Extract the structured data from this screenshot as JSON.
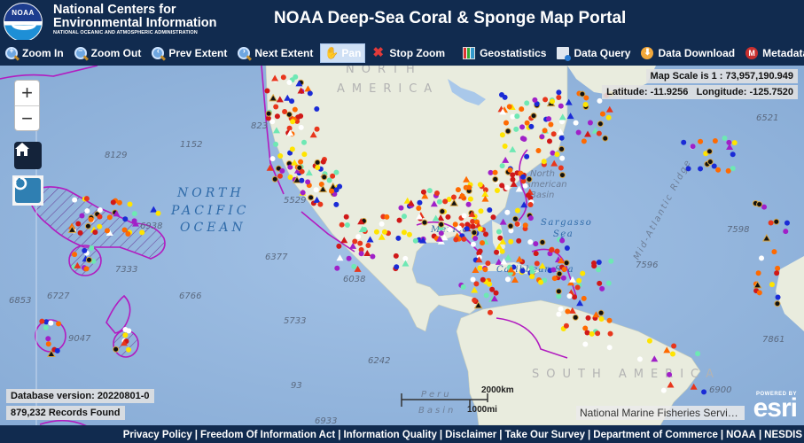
{
  "header": {
    "org_line1": "National Centers for",
    "org_line2": "Environmental Information",
    "org_sub": "NATIONAL OCEANIC AND ATMOSPHERIC ADMINISTRATION",
    "logo_text": "NOAA",
    "title": "NOAA Deep-Sea Coral & Sponge Map Portal"
  },
  "toolbar": {
    "items": [
      {
        "label": "Zoom In",
        "icon": "zoom-in-icon",
        "active": false
      },
      {
        "label": "Zoom Out",
        "icon": "zoom-out-icon",
        "active": false
      },
      {
        "label": "Prev Extent",
        "icon": "prev-extent-icon",
        "active": false
      },
      {
        "label": "Next Extent",
        "icon": "next-extent-icon",
        "active": false
      },
      {
        "label": "Pan",
        "icon": "pan-hand-icon",
        "active": true
      },
      {
        "label": "Stop Zoom",
        "icon": "stop-zoom-icon",
        "active": false
      },
      {
        "label": "Geostatistics",
        "icon": "bar-chart-icon",
        "active": false
      },
      {
        "label": "Data Query",
        "icon": "data-query-icon",
        "active": false
      },
      {
        "label": "Data Download",
        "icon": "download-icon",
        "active": false
      },
      {
        "label": "Metadata",
        "icon": "metadata-icon",
        "active": false
      }
    ]
  },
  "map": {
    "zoom_in_symbol": "+",
    "zoom_out_symbol": "−",
    "scale_text": "Map Scale is 1 : 73,957,190.949",
    "latlon_text": "Latitude: -11.9256   Longitude: -125.7520",
    "database_version": "Database version: 20220801-0",
    "records_found": "879,232 Records Found",
    "attribution": "National Marine Fisheries Servic...",
    "esri_powered": "POWERED BY",
    "esri_text": "esri",
    "scalebar_km": "2000km",
    "scalebar_mi": "1000mi",
    "labels": {
      "north_pacific": [
        "NORTH",
        "PACIFIC",
        "OCEAN"
      ],
      "north_america": [
        "NORTH",
        "AMERICA"
      ],
      "south_america": "SOUTH AMERICA",
      "mid_atlantic": "Mid-Atlantic Ridge",
      "na_basin": [
        "North",
        "American",
        "Basin"
      ],
      "sargasso": [
        "Sargasso",
        "Sea"
      ],
      "caribbean": "Caribbean Sea",
      "mexico": "Mexico",
      "peru_basin": [
        "Peru",
        "Basin"
      ]
    },
    "depths": [
      "8129",
      "1152",
      "823",
      "5529",
      "6938",
      "7333",
      "6727",
      "6853",
      "9047",
      "6766",
      "6377",
      "6038",
      "5733",
      "6242",
      "93",
      "6933",
      "6521",
      "7598",
      "7596",
      "7861",
      "6900"
    ]
  },
  "footer": {
    "links": [
      "Privacy Policy",
      "Freedom Of Information Act",
      "Information Quality",
      "Disclaimer",
      "Take Our Survey",
      "Department of Commerce",
      "NOAA",
      "NESDIS"
    ]
  }
}
